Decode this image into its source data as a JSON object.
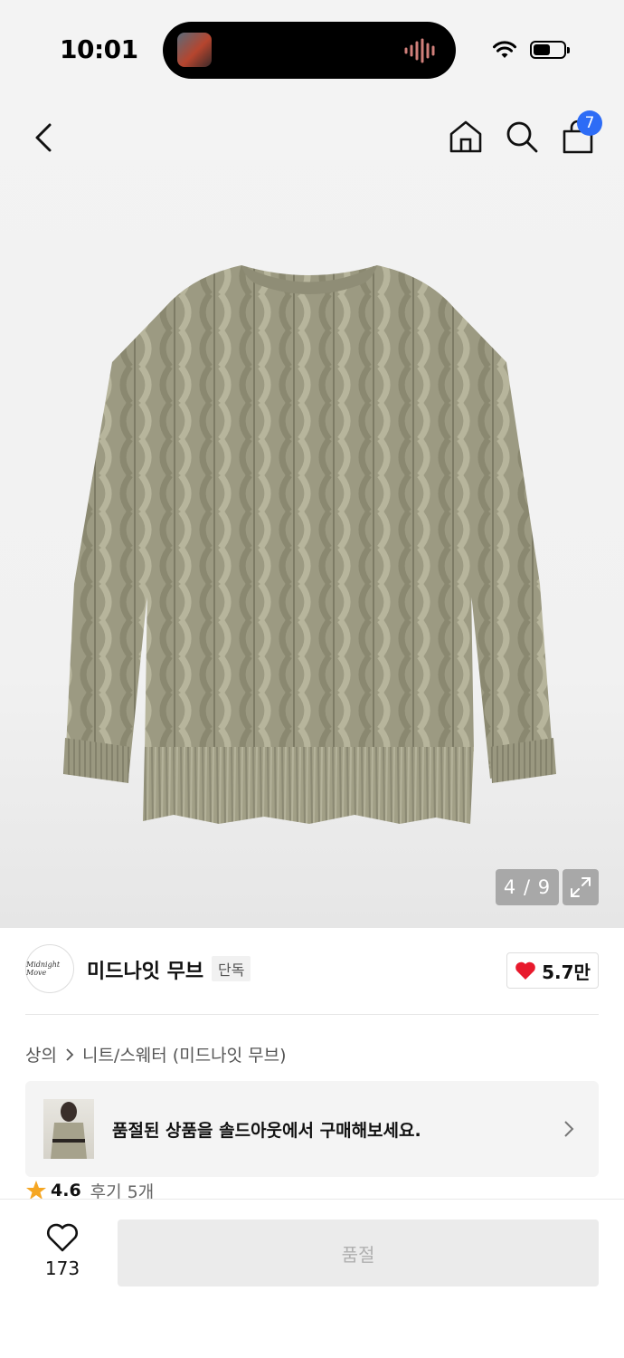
{
  "status": {
    "time": "10:01",
    "icons": [
      "wifi-icon",
      "battery-icon"
    ]
  },
  "header": {
    "icons": [
      "back-icon",
      "home-icon",
      "search-icon",
      "bag-icon"
    ],
    "cart_count": "7"
  },
  "gallery": {
    "counter": "4 / 9"
  },
  "brand": {
    "logo_text": "Midnight Move",
    "name": "미드나잇 무브",
    "tag": "단독",
    "likes": "5.7만"
  },
  "breadcrumb": {
    "items": [
      "상의",
      "니트/스웨터 (미드나잇 무브)"
    ]
  },
  "soldout_banner": {
    "text": "품절된 상품을 솔드아웃에서 구매해보세요."
  },
  "rating": {
    "value": "4.6",
    "reviews": "후기 5개"
  },
  "bottom_bar": {
    "wish_count": "173",
    "buy_label": "품절"
  },
  "colors": {
    "badge": "#2d6cf6",
    "heart": "#e8192c",
    "star": "#f5a623"
  }
}
